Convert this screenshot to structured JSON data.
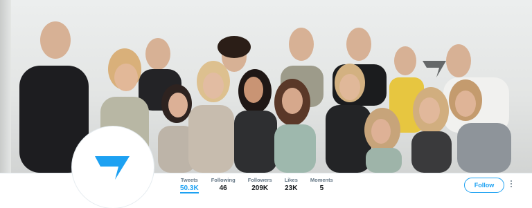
{
  "banner": {
    "description_icon": "group-photo",
    "brand_icon": "gymshark-shark-icon"
  },
  "avatar": {
    "icon": "gymshark-shark-icon",
    "color": "#1da1f2"
  },
  "stats": [
    {
      "label": "Tweets",
      "value": "50.3K",
      "active": true
    },
    {
      "label": "Following",
      "value": "46"
    },
    {
      "label": "Followers",
      "value": "209K"
    },
    {
      "label": "Likes",
      "value": "23K"
    },
    {
      "label": "Moments",
      "value": "5"
    }
  ],
  "actions": {
    "follow_label": "Follow",
    "more_icon": "more-vertical-icon"
  },
  "colors": {
    "accent": "#1da1f2",
    "text": "#14171a",
    "muted": "#657786"
  }
}
